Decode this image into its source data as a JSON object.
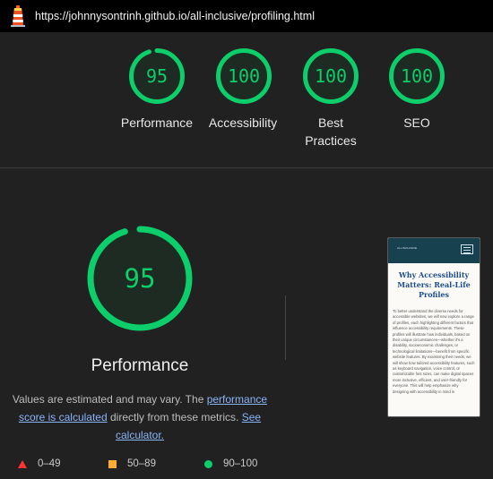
{
  "browser": {
    "url": "https://johnnysontrinh.github.io/all-inclusive/profiling.html",
    "icon": "lighthouse-icon"
  },
  "colors": {
    "pass": "#0cce6b",
    "average": "#ffaa33",
    "fail": "#ff3333",
    "link": "#8ab4f8",
    "background": "#212121"
  },
  "summary": {
    "gauges": [
      {
        "score": "95",
        "score_value": 95,
        "label": "Performance"
      },
      {
        "score": "100",
        "score_value": 100,
        "label": "Accessibility"
      },
      {
        "score": "100",
        "score_value": 100,
        "label": "Best Practices"
      },
      {
        "score": "100",
        "score_value": 100,
        "label": "SEO"
      }
    ]
  },
  "performance": {
    "score": "95",
    "score_value": 95,
    "title": "Performance",
    "note_before": "Values are estimated and may vary. The ",
    "note_link1": "performance score is calculated",
    "note_middle": " directly from these metrics. ",
    "note_link2": "See calculator."
  },
  "legend": [
    {
      "range": "0–49",
      "icon": "red-triangle-icon"
    },
    {
      "range": "50–89",
      "icon": "orange-square-icon"
    },
    {
      "range": "90–100",
      "icon": "green-circle-icon"
    }
  ],
  "screenshot_thumbnail": {
    "logo_text": "ALL INCLUSIVE",
    "heading": "Why Accessibility Matters: Real-Life Profiles",
    "body": "To better understand the diverse needs for accessible websites, we will now explore a range of profiles, each highlighting different factors that influence accessibility requirements. These profiles will illustrate how individuals, based on their unique circumstances—whether it's a disability, socioeconomic challenges, or technological limitations—benefit from specific website features. By examining their needs, we will show how tailored accessibility features, such as keyboard navigation, voice control, or customizable font sizes, can make digital spaces more inclusive, efficient, and user-friendly for everyone. This will help emphasize why designing with accessibility in mind is"
  }
}
